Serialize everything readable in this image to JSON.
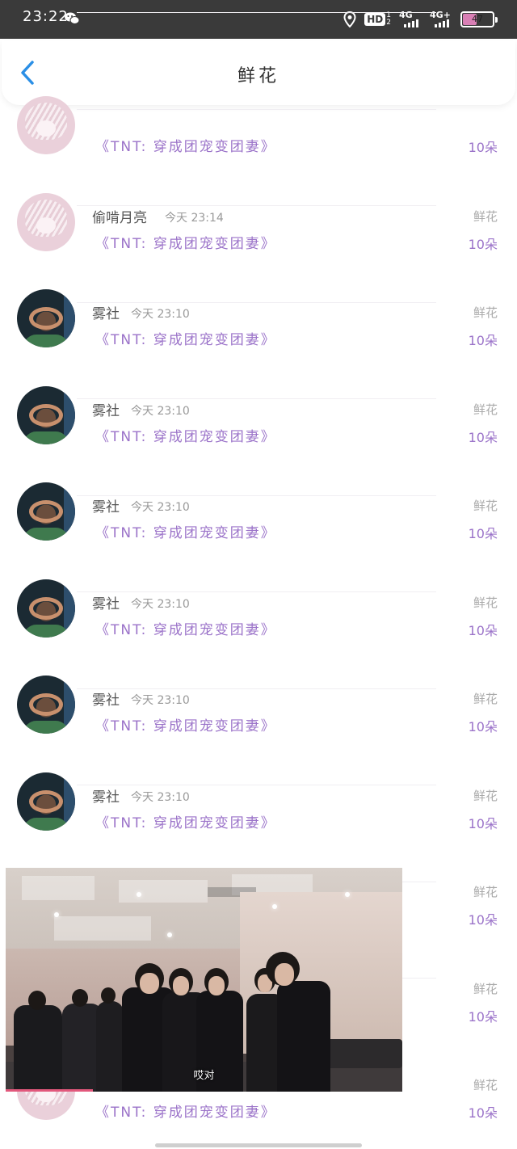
{
  "status_bar": {
    "time": "23:22",
    "network_1": "4G",
    "network_2": "4G+",
    "hd": "HD",
    "hd_sub_top": "1",
    "hd_sub_bottom": "2",
    "battery": "47",
    "battery_level_pct": 47
  },
  "header": {
    "title": "鲜花"
  },
  "rows": [
    {
      "name": "",
      "time": "",
      "book": "《TNT: 穿成团宠变团妻》",
      "gift_label": "",
      "gift_count": "10朵",
      "avatar": "pink-girl"
    },
    {
      "name": "偷啃月亮",
      "time": "今天 23:14",
      "book": "《TNT: 穿成团宠变团妻》",
      "gift_label": "鲜花",
      "gift_count": "10朵",
      "avatar": "pink-girl"
    },
    {
      "name": "雾社",
      "time": "今天 23:10",
      "book": "《TNT: 穿成团宠变团妻》",
      "gift_label": "鲜花",
      "gift_count": "10朵",
      "avatar": "dark-portrait"
    },
    {
      "name": "雾社",
      "time": "今天 23:10",
      "book": "《TNT: 穿成团宠变团妻》",
      "gift_label": "鲜花",
      "gift_count": "10朵",
      "avatar": "dark-portrait"
    },
    {
      "name": "雾社",
      "time": "今天 23:10",
      "book": "《TNT: 穿成团宠变团妻》",
      "gift_label": "鲜花",
      "gift_count": "10朵",
      "avatar": "dark-portrait"
    },
    {
      "name": "雾社",
      "time": "今天 23:10",
      "book": "《TNT: 穿成团宠变团妻》",
      "gift_label": "鲜花",
      "gift_count": "10朵",
      "avatar": "dark-portrait"
    },
    {
      "name": "雾社",
      "time": "今天 23:10",
      "book": "《TNT: 穿成团宠变团妻》",
      "gift_label": "鲜花",
      "gift_count": "10朵",
      "avatar": "dark-portrait"
    },
    {
      "name": "雾社",
      "time": "今天 23:10",
      "book": "《TNT: 穿成团宠变团妻》",
      "gift_label": "鲜花",
      "gift_count": "10朵",
      "avatar": "dark-portrait"
    },
    {
      "name": "",
      "time": "",
      "book": "",
      "gift_label": "鲜花",
      "gift_count": "10朵",
      "avatar": ""
    },
    {
      "name": "",
      "time": "",
      "book": "",
      "gift_label": "鲜花",
      "gift_count": "10朵",
      "avatar": ""
    },
    {
      "name": "",
      "time": "",
      "book": "《TNT: 穿成团宠变团妻》",
      "gift_label": "鲜花",
      "gift_count": "10朵",
      "avatar": "pink-girl"
    }
  ],
  "video": {
    "subtitle": "哎对",
    "progress_pct": 22
  },
  "colors": {
    "accent_purple": "#9b73c9",
    "back_blue": "#2b8fe6",
    "status_bg": "#3a3a3a",
    "progress": "#e2587c"
  },
  "icons": {
    "back": "chevron-left-icon",
    "wechat": "wechat-icon",
    "location": "location-icon"
  }
}
